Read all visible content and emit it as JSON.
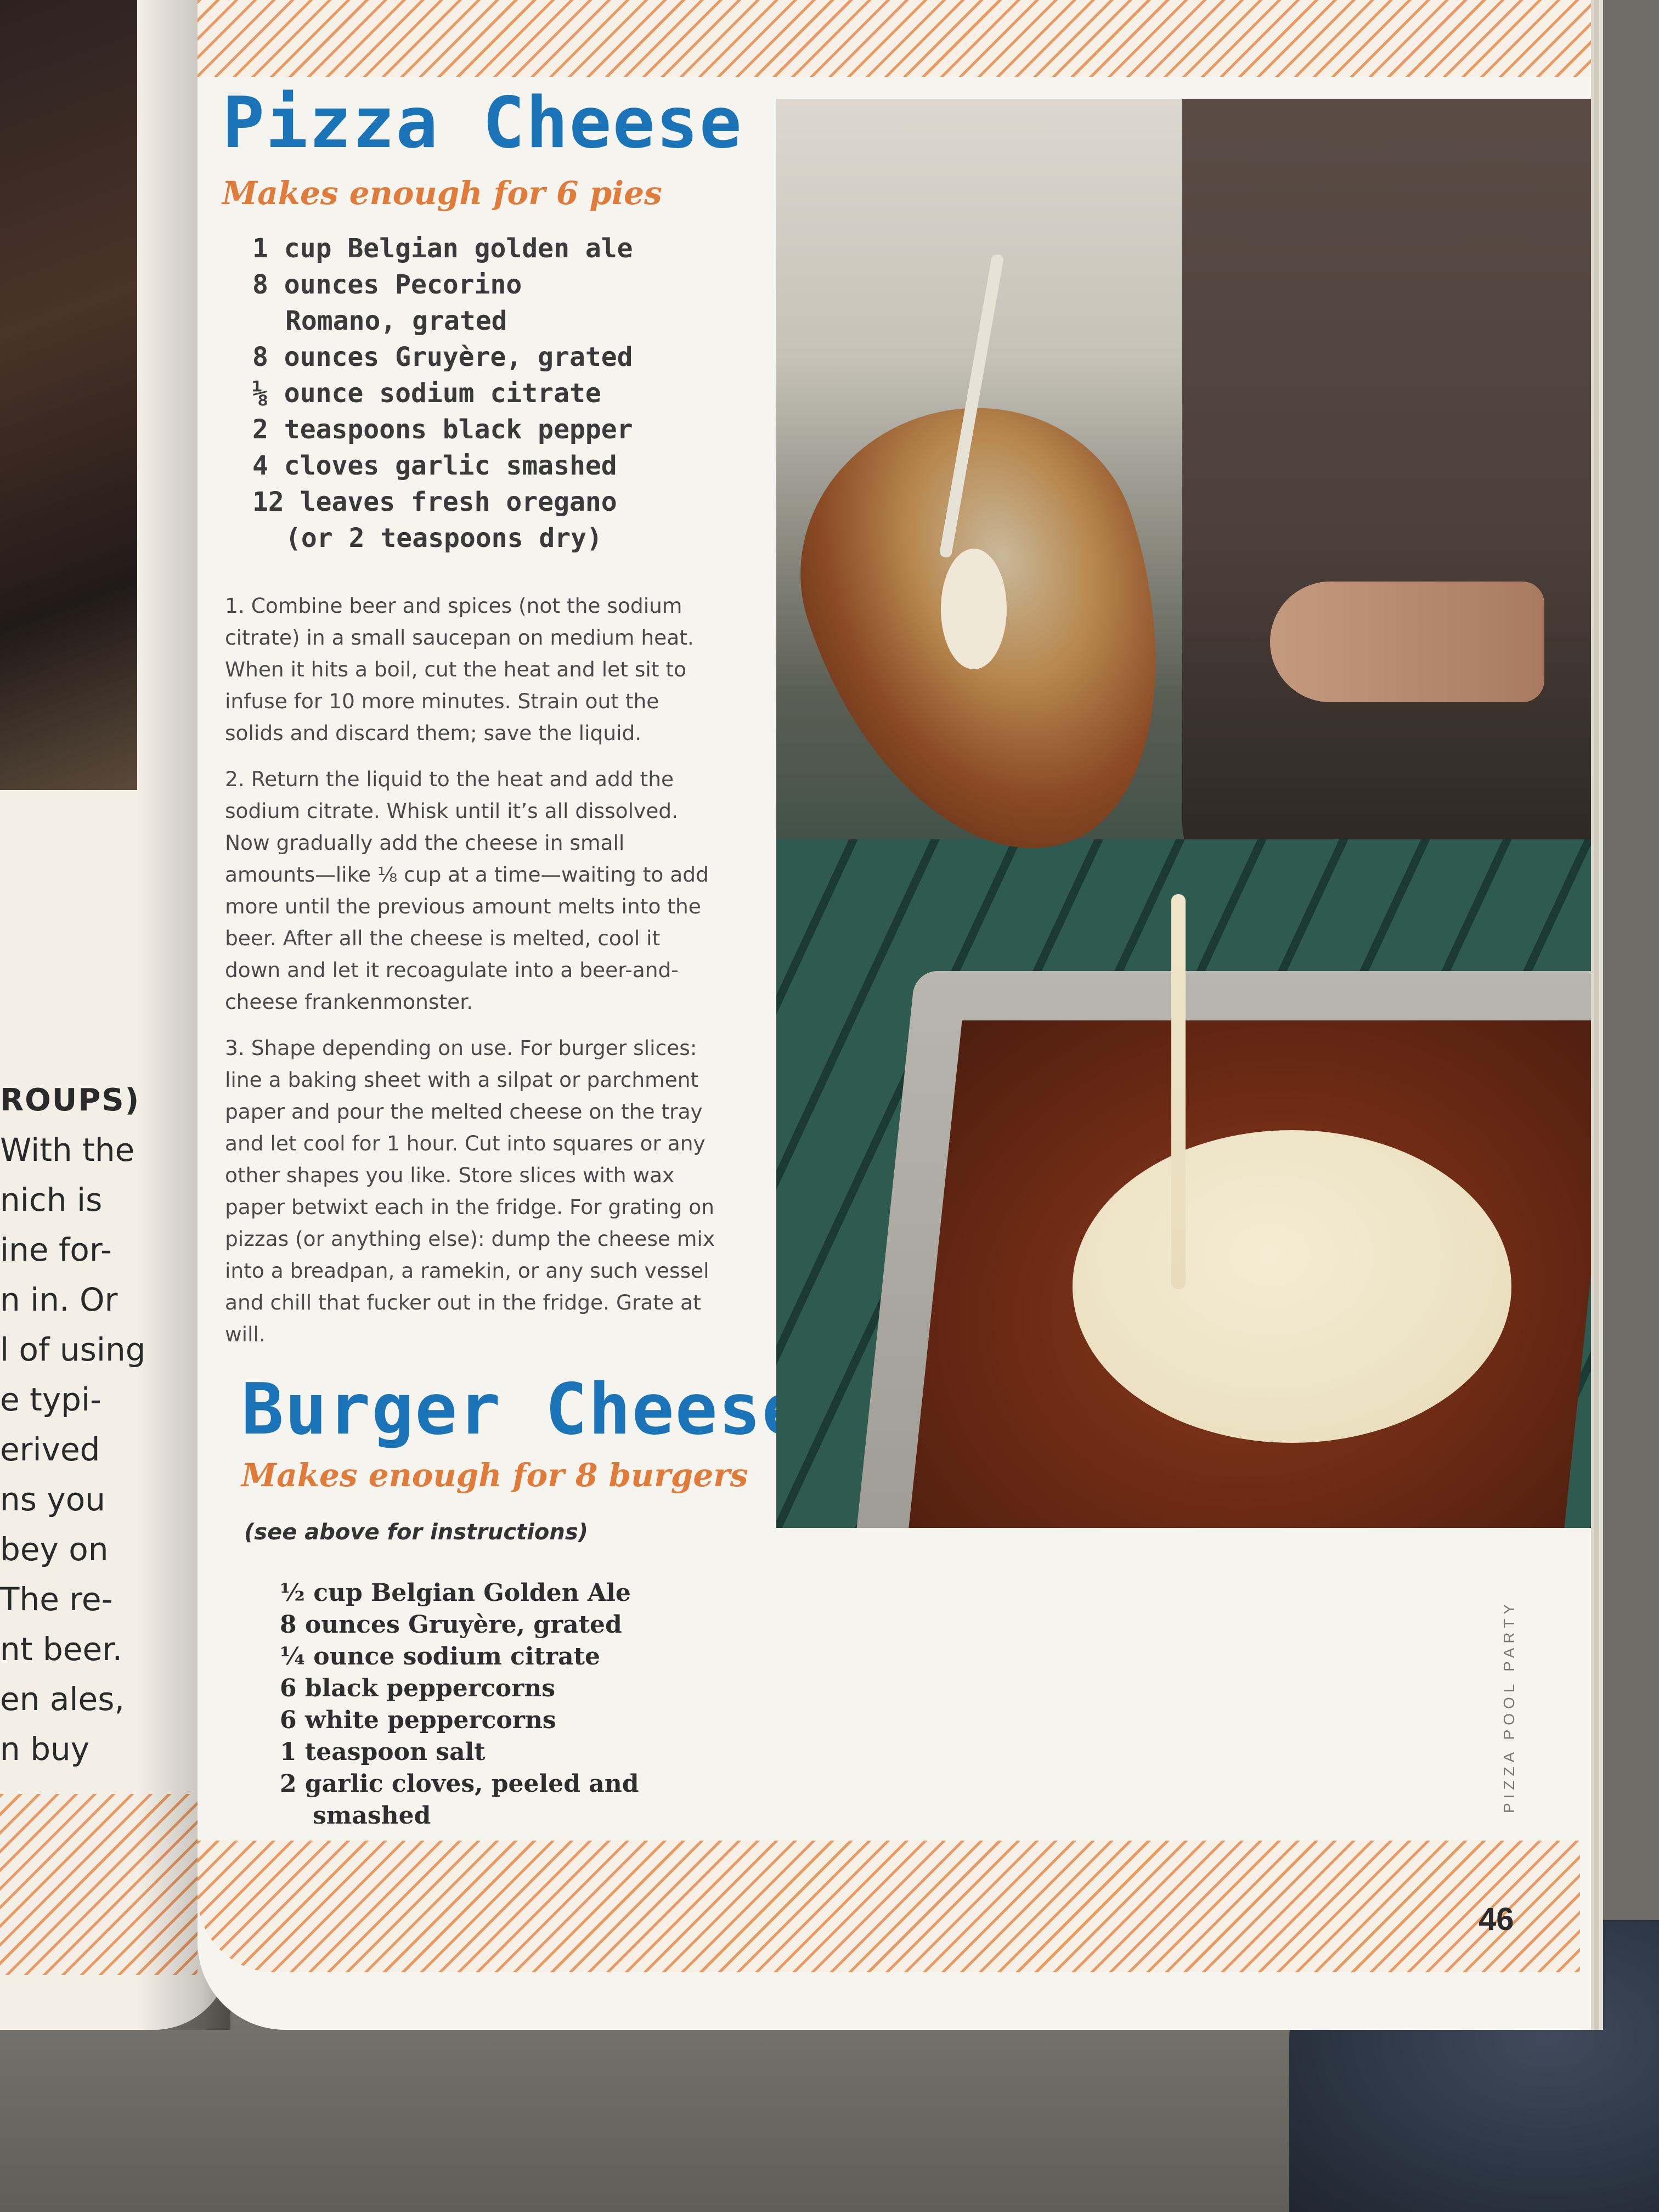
{
  "left_page": {
    "lines": [
      "ROUPS)",
      "With the",
      "nich is",
      "ine for-",
      "n in. Or",
      "l of using",
      "e typi-",
      "erived",
      "ns you",
      "bey on",
      "The re-",
      "nt beer.",
      "en ales,",
      "n buy"
    ]
  },
  "pizza": {
    "title": "Pizza Cheese",
    "yield": "Makes enough for 6 pies",
    "ingredients": [
      "1 cup Belgian golden ale",
      "8 ounces Pecorino Romano, grated",
      "8 ounces Gruyère, grated",
      "⅛ ounce sodium citrate",
      "2 teaspoons black pepper",
      "4 cloves garlic smashed",
      "12 leaves fresh oregano (or 2 teaspoons dry)"
    ],
    "steps": [
      "1. Combine beer and spices (not the sodium citrate) in a small saucepan on medium heat. When it hits a boil, cut the heat and let sit to infuse for 10 more minutes. Strain out the solids and discard them; save the liquid.",
      "2. Return the liquid to the heat and add the sodium citrate. Whisk until it’s all dissolved. Now gradually add the cheese in small amounts—like ⅛ cup at a time—waiting to add more until the previous amount melts into the beer. After all the cheese is melted, cool it down and let it recoagulate into a beer-and-cheese frankenmonster.",
      "3. Shape depending on use. For burger slices: line a baking sheet with a silpat or parchment paper and pour the melted cheese on the tray and let cool for 1 hour. Cut into squares or any other shapes you like. Store slices with wax paper betwixt each in the fridge. For grating on pizzas (or anything else): dump the cheese mix into a breadpan, a ramekin, or any such vessel and chill that fucker out in the fridge. Grate at will."
    ]
  },
  "burger": {
    "title": "Burger Cheese",
    "yield": "Makes enough for 8 burgers",
    "note": "(see above for instructions)",
    "ingredients": [
      "½ cup Belgian Golden Ale",
      "8 ounces Gruyère, grated",
      "¼ ounce sodium citrate",
      "6 black peppercorns",
      "6 white peppercorns",
      "1 teaspoon salt",
      "2 garlic cloves, peeled and smashed"
    ]
  },
  "footer": {
    "running_head": "PIZZA POOL PARTY",
    "page_number": "46"
  },
  "colors": {
    "title_blue": "#1b74b8",
    "yield_orange": "#e07b39",
    "stripe_orange": "#e99a63"
  }
}
